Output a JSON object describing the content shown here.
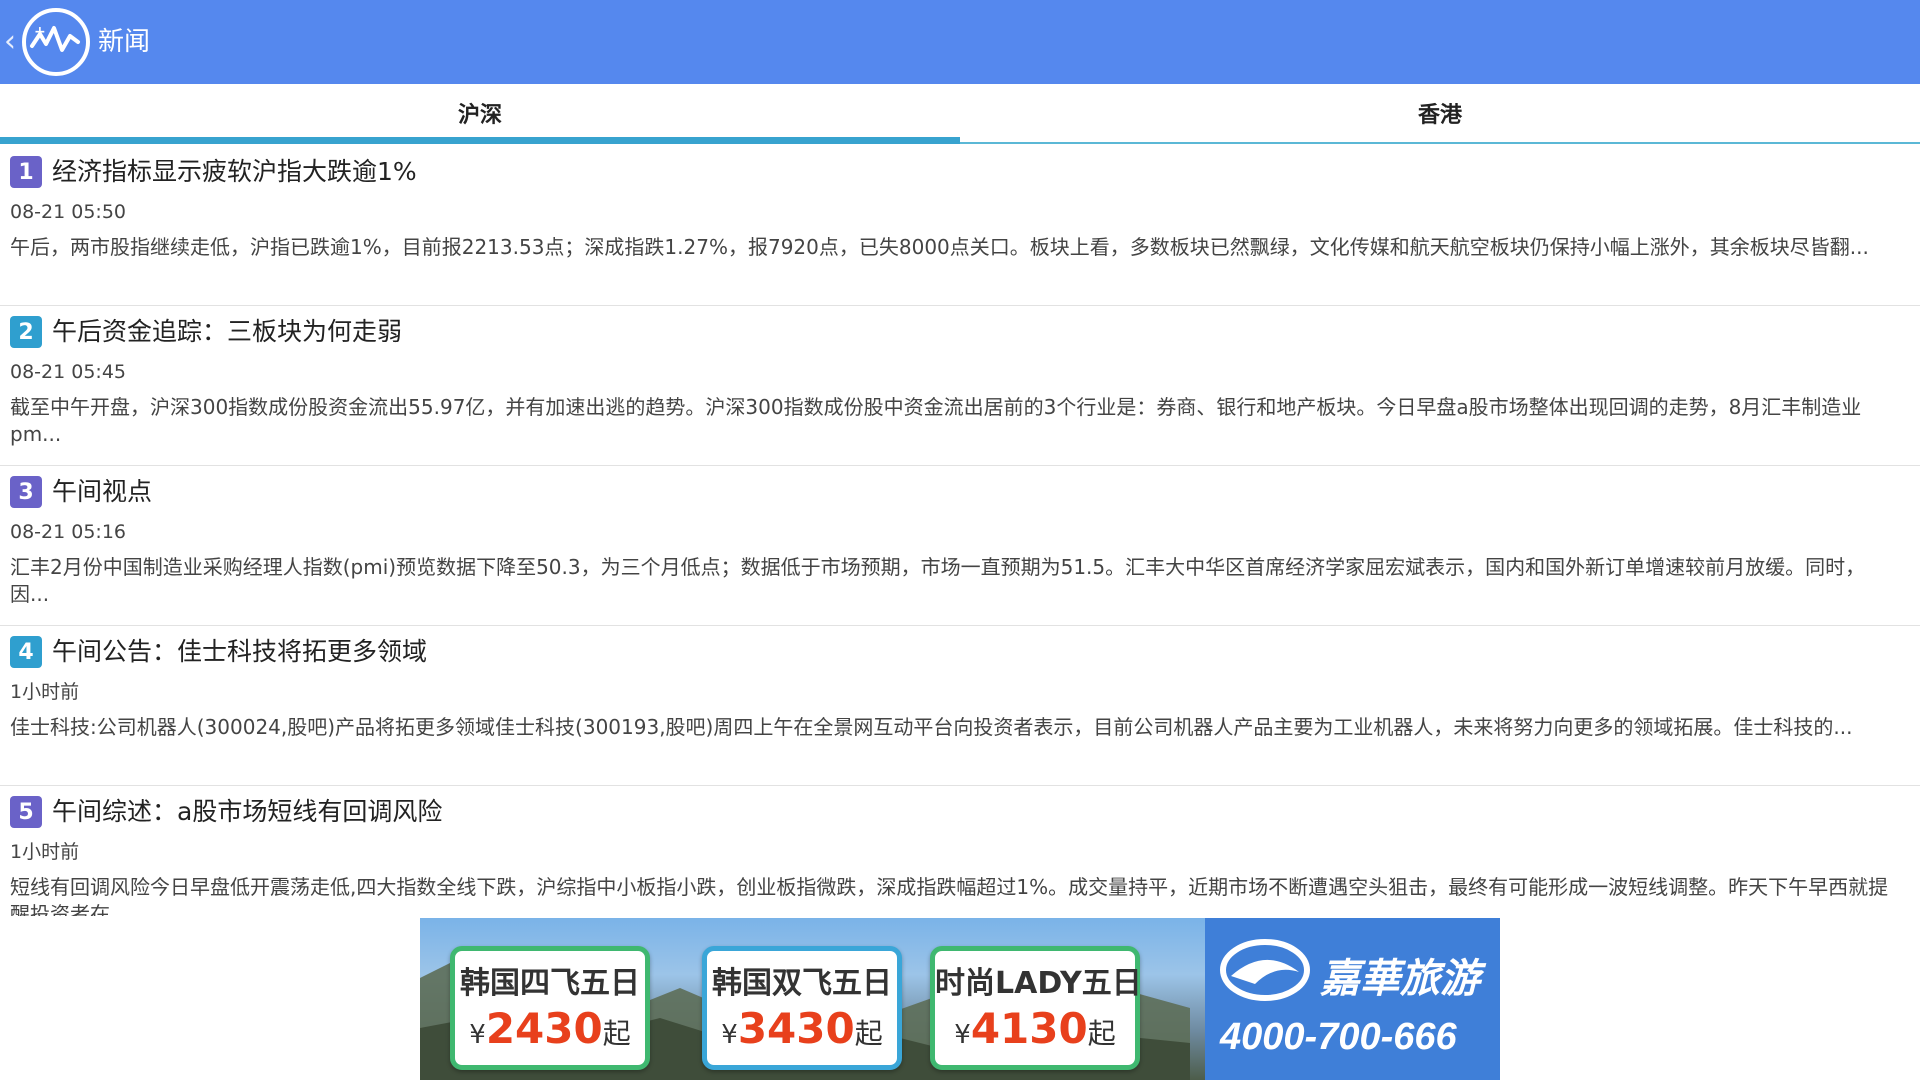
{
  "appbar": {
    "title": "新闻",
    "back_icon": "chevron-left-icon",
    "logo_icon": "stock-chart-logo-icon",
    "color": "#5588ee"
  },
  "tabs": [
    {
      "label": "沪深",
      "active": true
    },
    {
      "label": "香港",
      "active": false
    }
  ],
  "news": [
    {
      "num": "1",
      "badge_color": "#6a62c8",
      "title": "经济指标显示疲软沪指大跌逾1%",
      "time": "08-21 05:50",
      "summary": "午后，两市股指继续走低，沪指已跌逾1%，目前报2213.53点；深成指跌1.27%，报7920点，已失8000点关口。板块上看，多数板块已然飘绿，文化传媒和航天航空板块仍保持小幅上涨外，其余板块尽皆翻..."
    },
    {
      "num": "2",
      "badge_color": "#2f9fcf",
      "title": "午后资金追踪：三板块为何走弱",
      "time": "08-21 05:45",
      "summary": "截至中午开盘，沪深300指数成份股资金流出55.97亿，并有加速出逃的趋势。沪深300指数成份股中资金流出居前的3个行业是：券商、银行和地产板块。今日早盘a股市场整体出现回调的走势，8月汇丰制造业pm..."
    },
    {
      "num": "3",
      "badge_color": "#6a62c8",
      "title": "午间视点",
      "time": "08-21 05:16",
      "summary": "汇丰2月份中国制造业采购经理人指数(pmi)预览数据下降至50.3，为三个月低点；数据低于市场预期，市场一直预期为51.5。汇丰大中华区首席经济学家屈宏斌表示，国内和国外新订单增速较前月放缓。同时，因..."
    },
    {
      "num": "4",
      "badge_color": "#2f9fcf",
      "title": "午间公告：佳士科技将拓更多领域",
      "time": "1小时前",
      "summary": "佳士科技:公司机器人(300024,股吧)产品将拓更多领域佳士科技(300193,股吧)周四上午在全景网互动平台向投资者表示，目前公司机器人产品主要为工业机器人，未来将努力向更多的领域拓展。佳士科技的..."
    },
    {
      "num": "5",
      "badge_color": "#6a62c8",
      "title": "午间综述：a股市场短线有回调风险",
      "time": "1小时前",
      "summary": "短线有回调风险今日早盘低开震荡走低,四大指数全线下跌，沪综指中小板指小跌，创业板指微跌，深成指跌幅超过1%。成交量持平，近期市场不断遭遇空头狙击，最终有可能形成一波短线调整。昨天下午早西就提醒投资者在"
    }
  ],
  "ad": {
    "cards": [
      {
        "title": "韩国四飞五日",
        "yen": "¥",
        "price": "2430",
        "suffix": "起"
      },
      {
        "title": "韩国双飞五日",
        "yen": "¥",
        "price": "3430",
        "suffix": "起"
      },
      {
        "title": "时尚LADY五日",
        "yen": "¥",
        "price": "4130",
        "suffix": "起"
      }
    ],
    "brand_name": "嘉華旅游",
    "phone": "4000-700-666",
    "brand_icon": "travel-brand-logo-icon"
  }
}
